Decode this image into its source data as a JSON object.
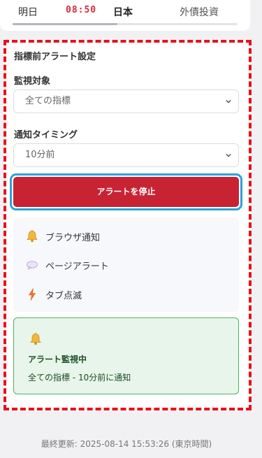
{
  "top_bar": {
    "day": "明日",
    "time": "08:50",
    "country": "日本",
    "category": "外債投資"
  },
  "alert_settings": {
    "title": "指標前アラート設定",
    "target_label": "監視対象",
    "target_value": "全ての指標",
    "timing_label": "通知タイミング",
    "timing_value": "10分前",
    "stop_button": "アラートを停止"
  },
  "notification_methods": [
    {
      "icon": "bell-icon",
      "label": "ブラウザ通知"
    },
    {
      "icon": "speech-bubble-icon",
      "label": "ページアラート"
    },
    {
      "icon": "lightning-icon",
      "label": "タブ点滅"
    }
  ],
  "status": {
    "icon": "bell-icon",
    "title": "アラート監視中",
    "detail": "全ての指標 - 10分前に通知"
  },
  "colors": {
    "accent_red": "#c82333",
    "time_red": "#d6293a",
    "focus_blue": "#2aa3d8",
    "status_green_bg": "#e8f5ea",
    "status_green_border": "#4fb160",
    "dashed_border": "#e8101e"
  },
  "footer": {
    "last_updated": "最終更新: 2025-08-14 15:53:26 (東京時間)"
  }
}
